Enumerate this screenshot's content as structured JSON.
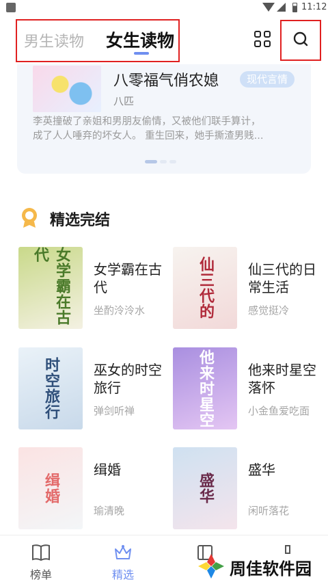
{
  "status_bar": {
    "time": "11:12"
  },
  "top_tabs": [
    {
      "label": "男生读物",
      "active": false
    },
    {
      "label": "女生读物",
      "active": true
    }
  ],
  "banner": {
    "title": "八零福气俏农媳",
    "tag": "现代言情",
    "author": "八匹",
    "description": "李英撞破了亲姐和男朋友偷情，又被他们联手算计，成了人人唾弃的坏女人。重生回来，她手撕渣男贱…",
    "description_line1": "李英撞破了亲姐和男朋友偷情，又被他们联手算计，",
    "description_line2": "成了人人唾弃的坏女人。 重生回来，她手撕渣男贱..."
  },
  "section": {
    "title": "精选完结",
    "icon": "medal-icon"
  },
  "books": [
    {
      "title": "女学霸在古代",
      "author": "坐酌泠泠水",
      "cover_text": "女学霸在古代",
      "cover_colors": [
        "#c9d98a",
        "#f4f1e3"
      ]
    },
    {
      "title": "仙三代的日常生活",
      "author": "感觉挺冷",
      "cover_text": "仙三代的",
      "cover_colors": [
        "#f7f3ef",
        "#f2d9d9"
      ]
    },
    {
      "title": "巫女的时空旅行",
      "author": "弹剑听禅",
      "cover_text": "时空旅行",
      "cover_colors": [
        "#eaf2f8",
        "#c8d9ea"
      ]
    },
    {
      "title": "他来时星空落怀",
      "author": "小金鱼爱吃面",
      "cover_text": "他来时星空",
      "cover_colors": [
        "#a98fe0",
        "#e4c6f3"
      ]
    },
    {
      "title": "缉婚",
      "author": "瑜清晚",
      "cover_text": "缉婚",
      "cover_colors": [
        "#fbe3e3",
        "#f3f6f8"
      ]
    },
    {
      "title": "盛华",
      "author": "闲听落花",
      "cover_text": "盛华",
      "cover_colors": [
        "#cfe1f1",
        "#f4e4ec"
      ]
    }
  ],
  "bottom_nav": [
    {
      "label": "榜单",
      "icon": "book-icon",
      "active": false
    },
    {
      "label": "精选",
      "icon": "crown-icon",
      "active": true
    },
    {
      "label": "",
      "icon": "bookshelf-icon",
      "active": false
    },
    {
      "label": "",
      "icon": "user-icon",
      "active": false
    }
  ],
  "watermark": {
    "text": "周佳软件园"
  },
  "colors": {
    "accent": "#6f8ff0",
    "highlight_box": "#e02020",
    "banner_bg": "#f3f6fb"
  }
}
